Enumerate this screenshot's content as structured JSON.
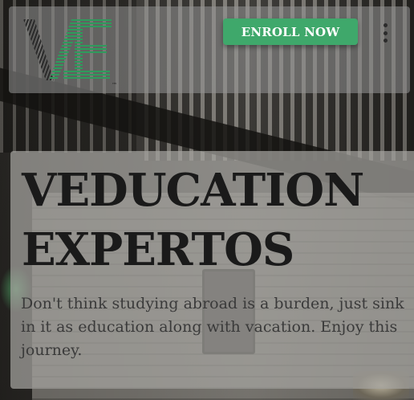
{
  "header": {
    "logo_text": "VE",
    "logo_trademark": "™",
    "enroll_label": "ENROLL NOW",
    "menu_icon": "more-vertical-icon"
  },
  "hero": {
    "title": "VEDUCATION EXPERTOS",
    "description": "Don't think studying abroad is a burden, just sink in it as education along with vacation. Enjoy this journey."
  },
  "colors": {
    "accent": "#3fa86b",
    "title": "#1a1a1a",
    "body_text": "#3a3a3a"
  }
}
